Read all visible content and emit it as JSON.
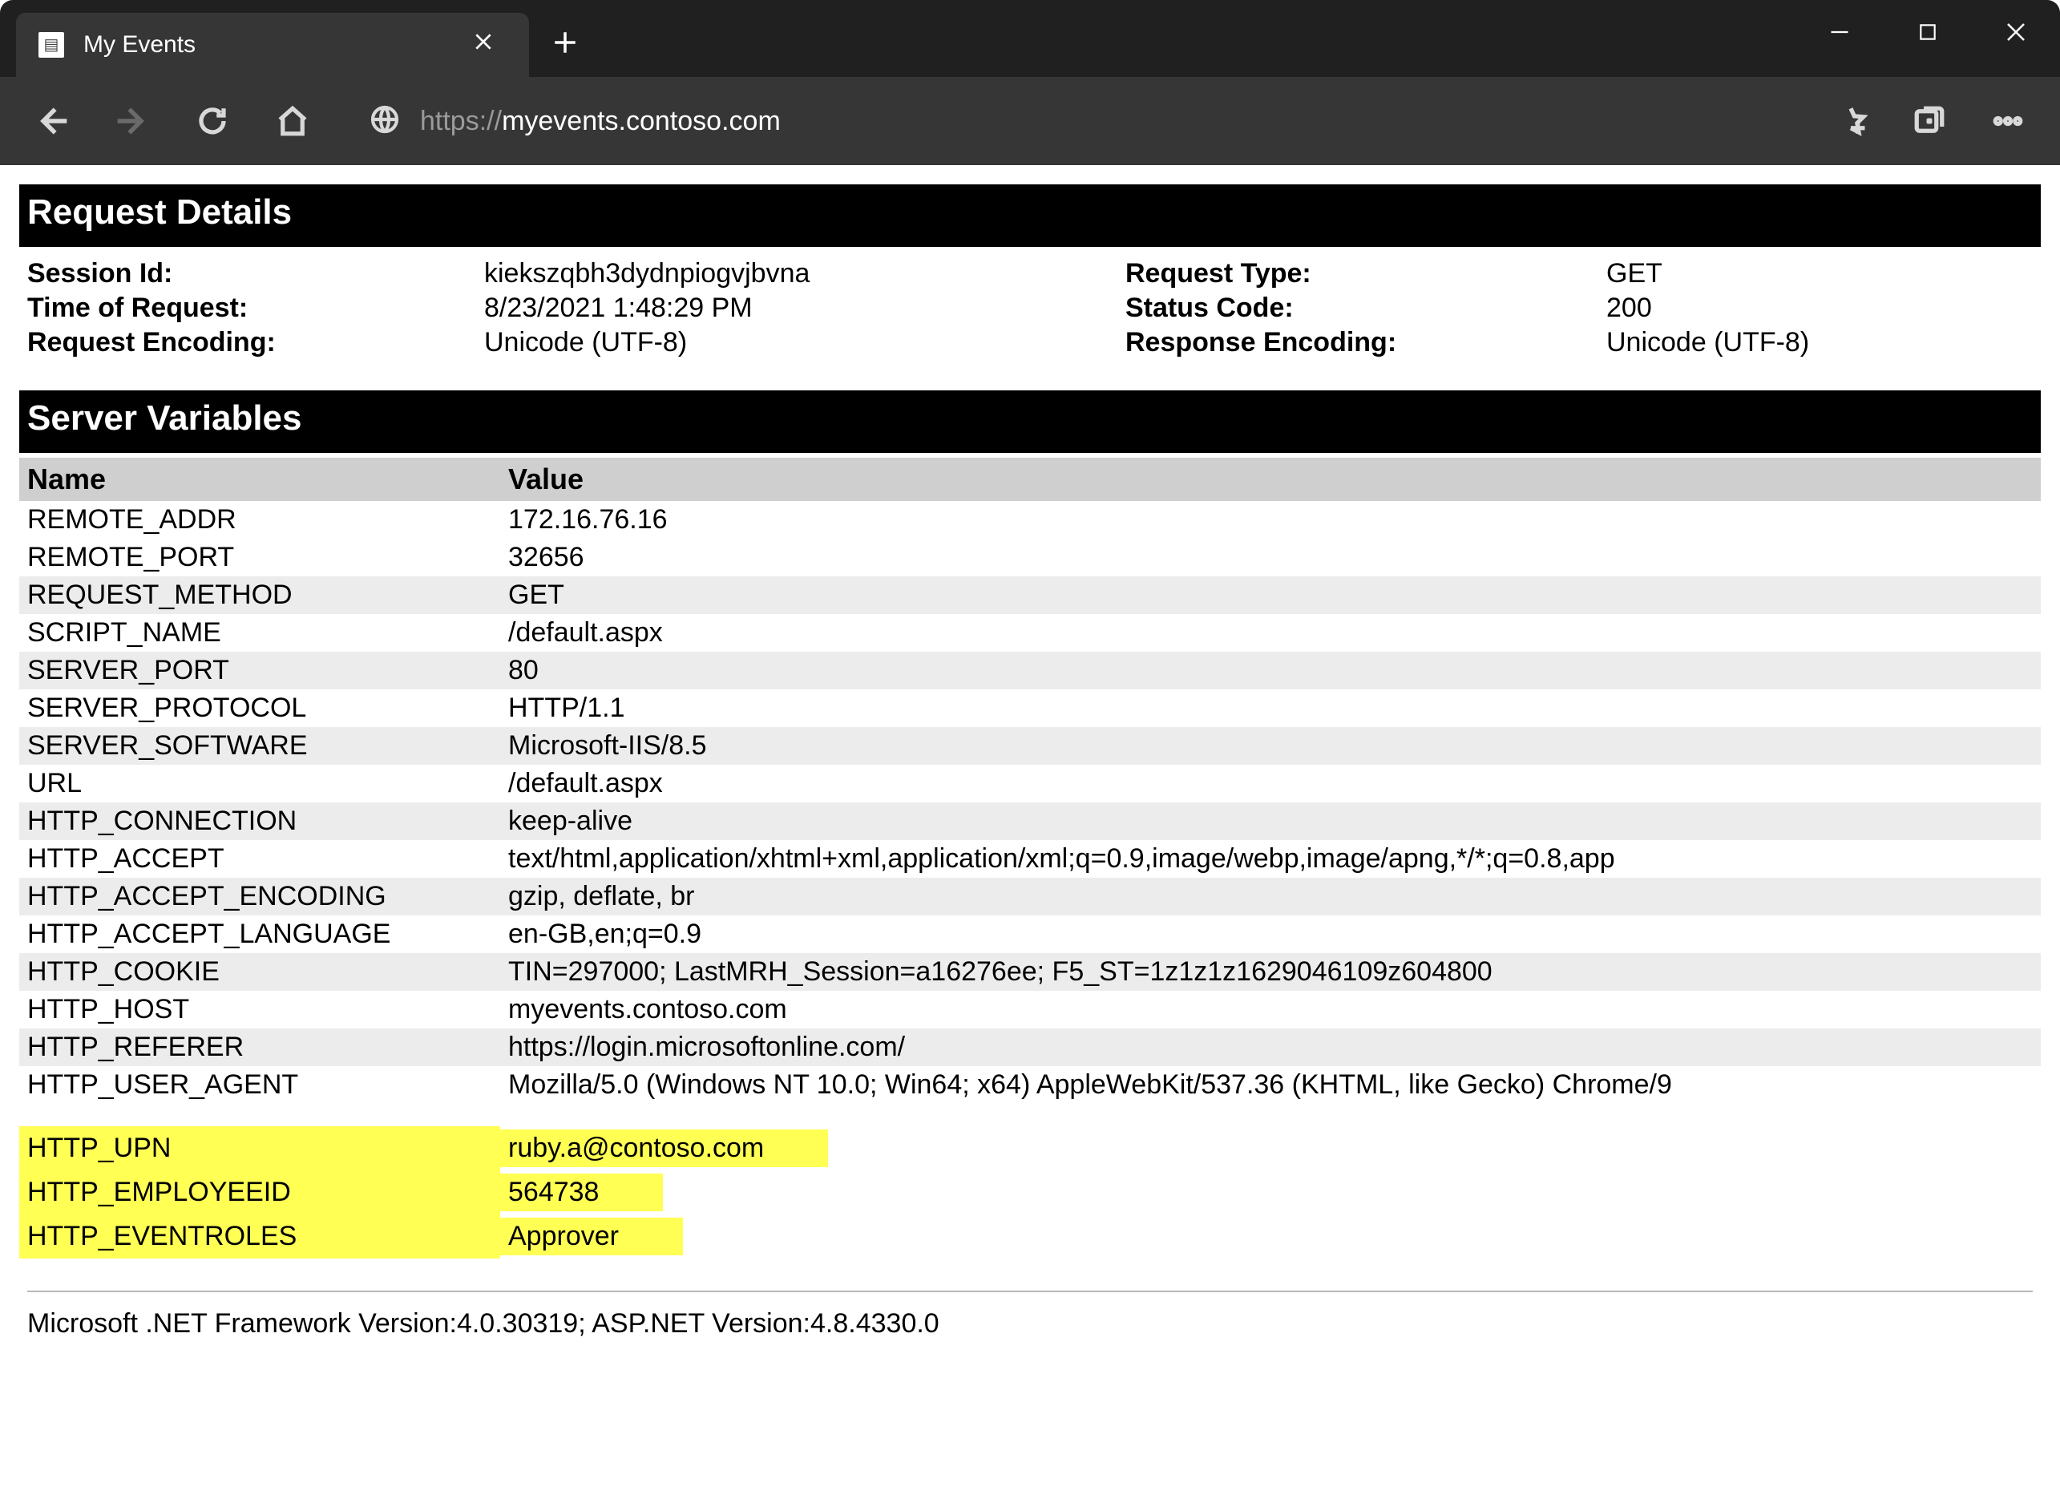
{
  "window": {
    "tab_title": "My Events",
    "url_scheme": "https://",
    "url_host": "myevents.contoso.com"
  },
  "sections": {
    "request_details_title": "Request Details",
    "server_variables_title": "Server Variables"
  },
  "request": {
    "labels": {
      "session_id": "Session Id:",
      "time_of_request": "Time of Request:",
      "request_encoding": "Request Encoding:",
      "request_type": "Request Type:",
      "status_code": "Status Code:",
      "response_encoding": "Response Encoding:"
    },
    "session_id": "kiekszqbh3dydnpiogvjbvna",
    "time_of_request": "8/23/2021 1:48:29 PM",
    "request_encoding": "Unicode (UTF-8)",
    "request_type": "GET",
    "status_code": "200",
    "response_encoding": "Unicode (UTF-8)"
  },
  "server_vars": {
    "headers": {
      "name": "Name",
      "value": "Value"
    },
    "rows": [
      {
        "name": "REMOTE_ADDR",
        "value": "172.16.76.16",
        "alt": false
      },
      {
        "name": "REMOTE_PORT",
        "value": "32656",
        "alt": false
      },
      {
        "name": "REQUEST_METHOD",
        "value": "GET",
        "alt": true
      },
      {
        "name": "SCRIPT_NAME",
        "value": "/default.aspx",
        "alt": false
      },
      {
        "name": "SERVER_PORT",
        "value": "80",
        "alt": true
      },
      {
        "name": "SERVER_PROTOCOL",
        "value": "HTTP/1.1",
        "alt": false
      },
      {
        "name": "SERVER_SOFTWARE",
        "value": "Microsoft-IIS/8.5",
        "alt": true
      },
      {
        "name": "URL",
        "value": "/default.aspx",
        "alt": false
      },
      {
        "name": "HTTP_CONNECTION",
        "value": "keep-alive",
        "alt": true
      },
      {
        "name": "HTTP_ACCEPT",
        "value": "text/html,application/xhtml+xml,application/xml;q=0.9,image/webp,image/apng,*/*;q=0.8,app",
        "alt": false
      },
      {
        "name": "HTTP_ACCEPT_ENCODING",
        "value": "gzip, deflate, br",
        "alt": true
      },
      {
        "name": "HTTP_ACCEPT_LANGUAGE",
        "value": "en-GB,en;q=0.9",
        "alt": false
      },
      {
        "name": "HTTP_COOKIE",
        "value": "TIN=297000; LastMRH_Session=a16276ee; F5_ST=1z1z1z1629046109z604800",
        "alt": true
      },
      {
        "name": "HTTP_HOST",
        "value": "myevents.contoso.com",
        "alt": false
      },
      {
        "name": "HTTP_REFERER",
        "value": "https://login.microsoftonline.com/",
        "alt": true
      },
      {
        "name": "HTTP_USER_AGENT",
        "value": "Mozilla/5.0 (Windows NT 10.0; Win64; x64) AppleWebKit/537.36 (KHTML, like Gecko) Chrome/9",
        "alt": false
      }
    ],
    "highlighted": [
      {
        "name": "HTTP_UPN",
        "value": "ruby.a@contoso.com"
      },
      {
        "name": "HTTP_EMPLOYEEID",
        "value": "564738"
      },
      {
        "name": "HTTP_EVENTROLES",
        "value": "Approver"
      }
    ]
  },
  "footer": "Microsoft .NET Framework Version:4.0.30319; ASP.NET Version:4.8.4330.0"
}
